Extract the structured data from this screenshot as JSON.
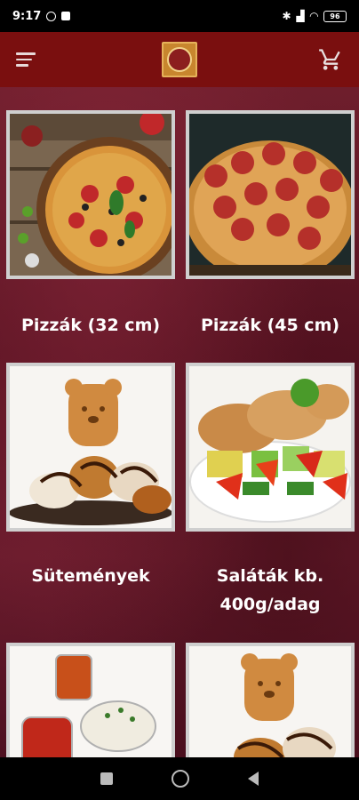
{
  "status_bar": {
    "time": "9:17",
    "battery": "96"
  },
  "app_bar": {
    "menu_icon": "hamburger-menu-icon",
    "logo": "restaurant-logo",
    "cart_icon": "shopping-cart-icon"
  },
  "colors": {
    "app_bar": "#7a0f0f",
    "background": "#5a1423",
    "tile_border": "#cfcfcf",
    "text": "#ffffff"
  },
  "categories": [
    {
      "label": "Pizzák (32 cm)",
      "image": "pizza-32cm-image"
    },
    {
      "label": "Pizzák (45 cm)",
      "image": "pizza-45cm-image"
    },
    {
      "label": "Sütemények",
      "image": "pastries-image"
    },
    {
      "label": "Saláták kb. 400g/adag",
      "image": "salad-image"
    },
    {
      "label": "",
      "image": "sauces-image"
    },
    {
      "label": "",
      "image": "pastries-image-2"
    }
  ],
  "nav_bar": {
    "recents_icon": "recents-icon",
    "home_icon": "home-icon",
    "back_icon": "back-icon"
  }
}
